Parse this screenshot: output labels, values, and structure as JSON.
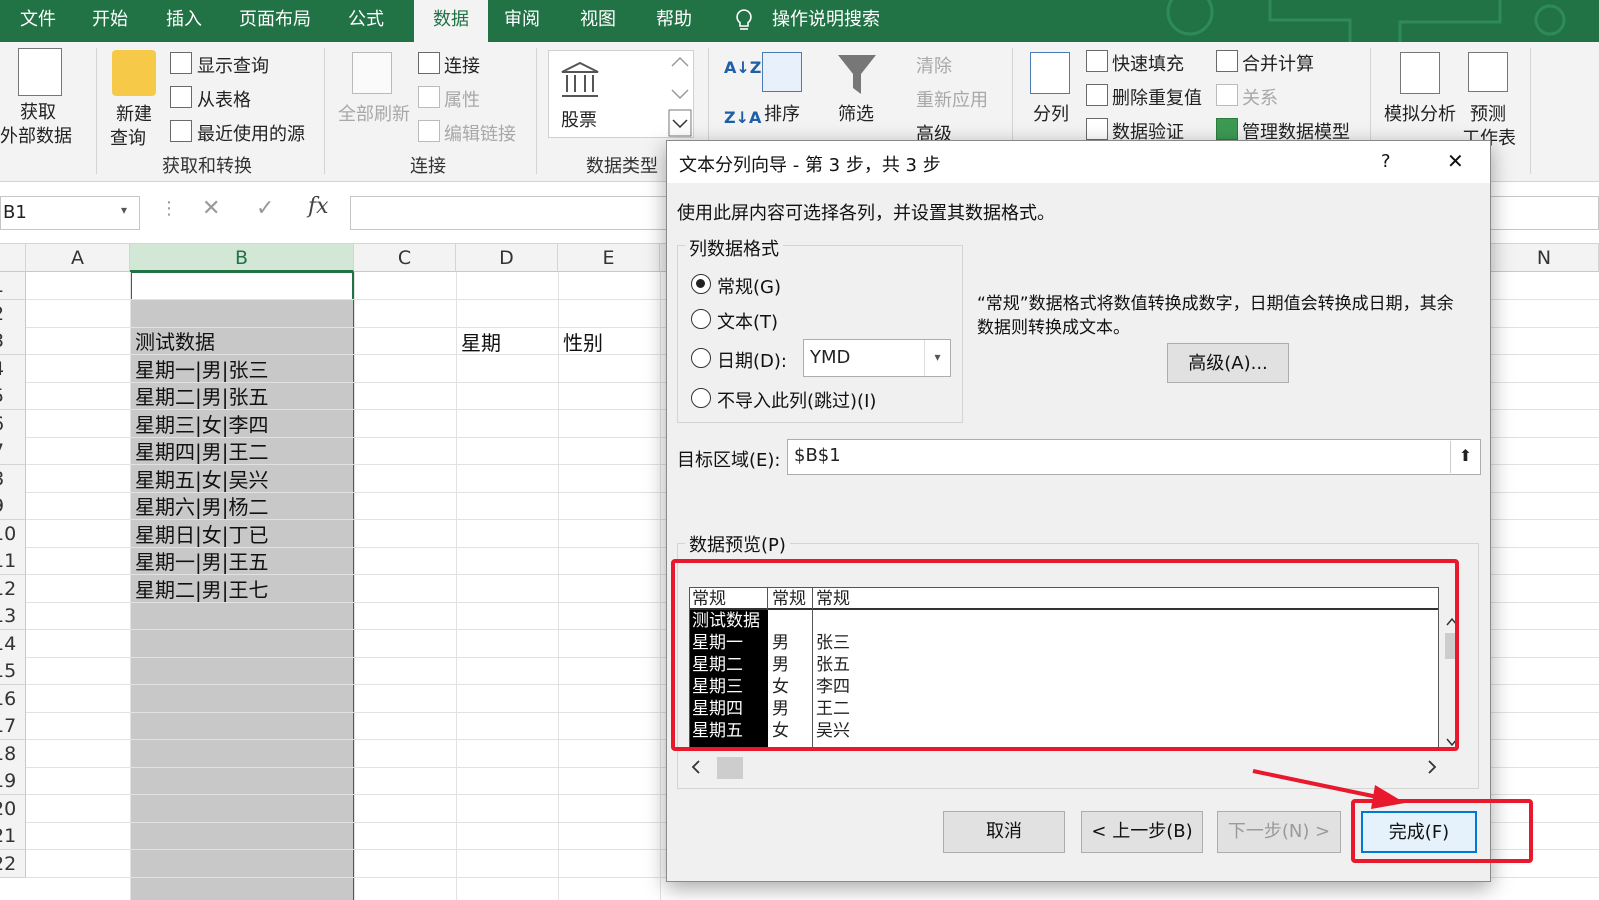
{
  "ribbon_tabs": [
    "文件",
    "开始",
    "插入",
    "页面布局",
    "公式",
    "数据",
    "审阅",
    "视图",
    "帮助",
    "操作说明搜索"
  ],
  "active_tab": "数据",
  "ribbon": {
    "get_data": [
      "获取",
      "外部数据"
    ],
    "new_query": [
      "新建",
      "查询"
    ],
    "show_query": "显示查询",
    "from_table": "从表格",
    "recent_sources": "最近使用的源",
    "group_get_transform": "获取和转换",
    "refresh_all": "全部刷新",
    "connections": "连接",
    "properties": "属性",
    "edit_links": "编辑链接",
    "group_connections": "连接",
    "stocks": "股票",
    "group_data_types": "数据类型",
    "sort": "排序",
    "filter": "筛选",
    "clear": "清除",
    "reapply": "重新应用",
    "advanced": "高级",
    "text_to_columns": "分列",
    "flash_fill": "快速填充",
    "remove_duplicates": "删除重复值",
    "data_validation": "数据验证",
    "consolidate": "合并计算",
    "relationships": "关系",
    "manage_model": "管理数据模型",
    "what_if": "模拟分析",
    "forecast": [
      "预测",
      "工作表"
    ]
  },
  "formula_bar": {
    "name_box": "B1",
    "fx": "fx",
    "value": ""
  },
  "sheet": {
    "columns": [
      "A",
      "B",
      "C",
      "D",
      "E",
      "N"
    ],
    "rows": [
      "1",
      "2",
      "3",
      "4",
      "5",
      "6",
      "7",
      "8",
      "9",
      "10",
      "11",
      "12",
      "13",
      "14",
      "15",
      "16",
      "17",
      "18",
      "19",
      "20",
      "21",
      "22"
    ],
    "b_cells": [
      "",
      "",
      "测试数据",
      "星期一|男|张三",
      "星期二|男|张五",
      "星期三|女|李四",
      "星期四|男|王二",
      "星期五|女|吴兴",
      "星期六|男|杨二",
      "星期日|女|丁已",
      "星期一|男|王五",
      "星期二|男|王七"
    ],
    "d3": "星期",
    "e3": "性别"
  },
  "dialog": {
    "title": "文本分列向导 - 第 3 步，共 3 步",
    "help": "?",
    "close": "✕",
    "instruction": "使用此屏内容可选择各列，并设置其数据格式。",
    "format_group": "列数据格式",
    "radio_general": "常规(G)",
    "radio_text": "文本(T)",
    "radio_date": "日期(D):",
    "date_format": "YMD",
    "radio_skip": "不导入此列(跳过)(I)",
    "description": [
      "“常规”数据格式将数值转换成数字，日期值会转换成日期，其余",
      "数据则转换成文本。"
    ],
    "advanced_button": "高级(A)...",
    "destination_label": "目标区域(E):",
    "destination_value": "$B$1",
    "preview_label": "数据预览(P)",
    "preview_headers": [
      "常规",
      "常规",
      "常规"
    ],
    "preview_col1": [
      "测试数据",
      "星期一",
      "星期二",
      "星期三",
      "星期四",
      "星期五"
    ],
    "preview_col2": [
      "",
      "男",
      "男",
      "女",
      "男",
      "女"
    ],
    "preview_col3": [
      "",
      "张三",
      "张五",
      "李四",
      "王二",
      "吴兴"
    ],
    "cancel": "取消",
    "back": "< 上一步(B)",
    "next": "下一步(N) >",
    "finish": "完成(F)"
  },
  "colors": {
    "excel_green": "#217346",
    "highlight_red": "#e8192c",
    "selection_gray": "#c8c8c8"
  }
}
